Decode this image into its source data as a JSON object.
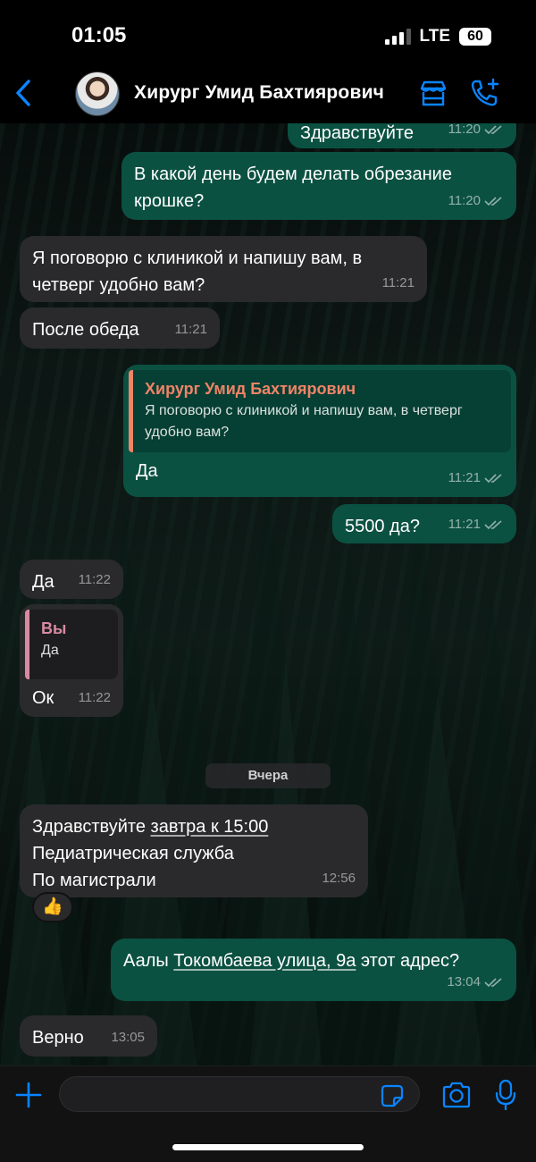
{
  "status": {
    "time": "01:05",
    "network": "LTE",
    "battery": "60"
  },
  "header": {
    "contact_name": "Хирург Умид Бахтиярович"
  },
  "messages": [
    {
      "text": "Здравствуйте",
      "time": "11:20"
    },
    {
      "text_line1": "В какой день будем делать обрезание",
      "text_line2": "крошке?",
      "time": "11:20"
    },
    {
      "text_line1": "Я поговорю с клиникой и напишу вам, в",
      "text_line2": "четверг удобно вам?",
      "time": "11:21"
    },
    {
      "text": "После обеда",
      "time": "11:21"
    },
    {
      "quote_author": "Хирург Умид Бахтиярович",
      "quote_line1": "Я поговорю с клиникой и напишу вам, в четверг",
      "quote_line2": "удобно вам?",
      "text": "Да",
      "time": "11:21"
    },
    {
      "text": "5500 да?",
      "time": "11:21"
    },
    {
      "text": "Да",
      "time": "11:22"
    },
    {
      "quote_author": "Вы",
      "quote_text": "Да",
      "text": "Ок",
      "time": "11:22"
    },
    {
      "text_a": "Здравствуйте ",
      "link": "завтра к 15:00",
      "line2": "Педиатрическая служба",
      "line3": "По магистрали",
      "time": "12:56",
      "reaction": "👍"
    },
    {
      "text_a": "Аалы ",
      "link": "Токомбаева улица, 9а",
      "text_b": " этот адрес?",
      "time": "13:04"
    },
    {
      "text": "Верно",
      "time": "13:05"
    }
  ],
  "date_separator": "Вчера",
  "composer": {
    "value": "",
    "placeholder": ""
  },
  "colors": {
    "accent": "#0a84ff",
    "outgoing_bubble": "#0b5142",
    "incoming_bubble": "#2a2a2c",
    "quote_author_out": "#f08468",
    "quote_author_in": "#d98aa1"
  }
}
